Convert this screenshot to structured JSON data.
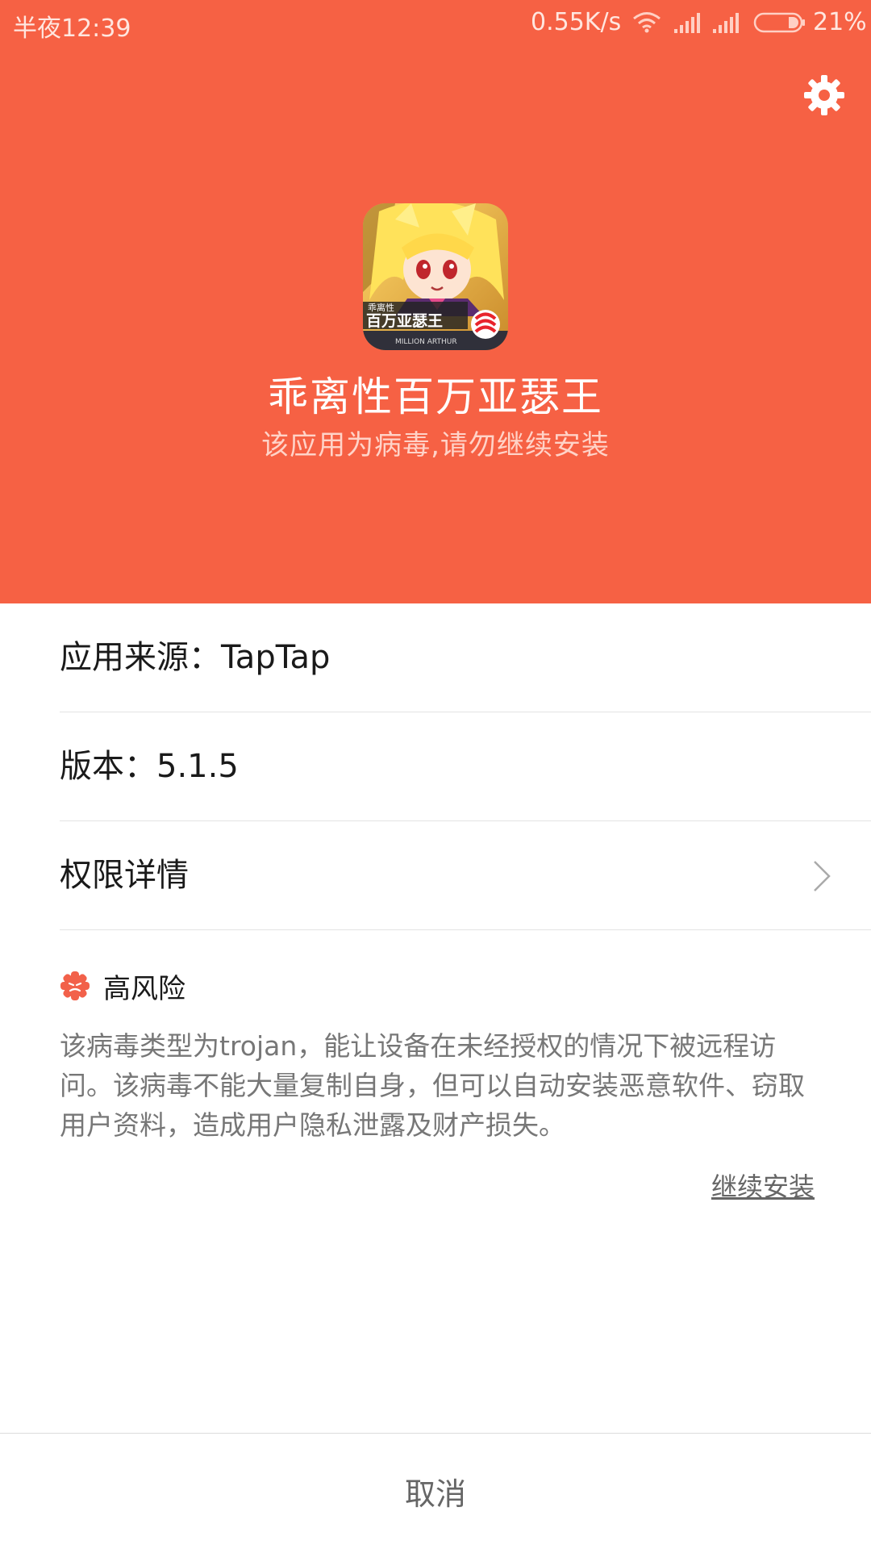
{
  "status_bar": {
    "time": "半夜12:39",
    "network_speed": "0.55K/s",
    "battery": "21%",
    "icons": [
      "wifi-icon",
      "signal-icon",
      "signal-icon",
      "battery-icon"
    ]
  },
  "header": {
    "settings_icon": "gear-icon",
    "app_name": "乖离性百万亚瑟王",
    "warning": "该应用为病毒,请勿继续安装",
    "app_icon_text": "乖离性百万亚瑟王",
    "accent_color": "#f66144"
  },
  "details": {
    "source_label": "应用来源：TapTap",
    "version_label": "版本：5.1.5",
    "permissions_label": "权限详情"
  },
  "risk": {
    "level": "高风险",
    "description": "该病毒类型为trojan，能让设备在未经授权的情况下被远程访问。该病毒不能大量复制自身，但可以自动安装恶意软件、窃取用户资料，造成用户隐私泄露及财产损失。",
    "continue_label": "继续安装"
  },
  "actions": {
    "cancel_label": "取消"
  }
}
